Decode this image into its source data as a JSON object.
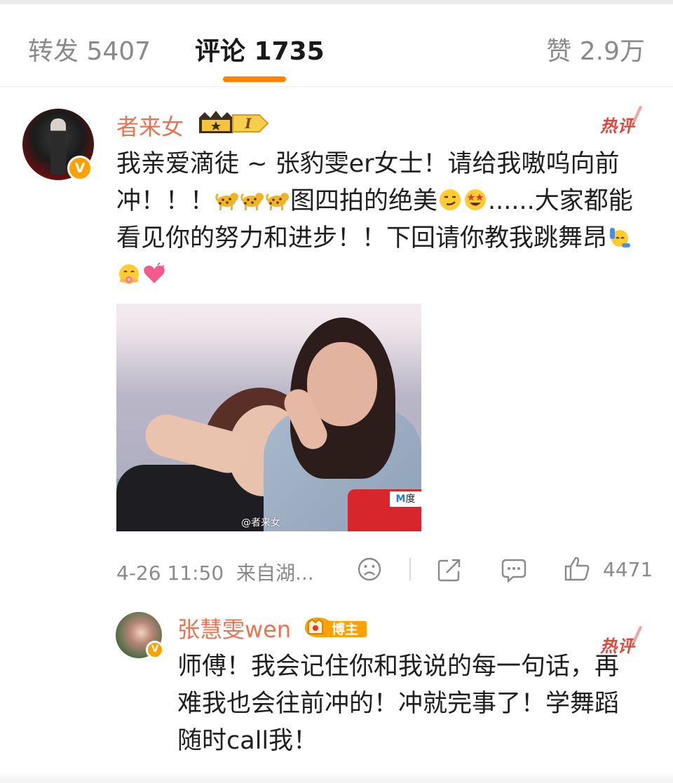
{
  "tabs": {
    "repost": "转发 5407",
    "comments": "评论 1735",
    "likes": "赞 2.9万"
  },
  "colors": {
    "accent": "#ff8200",
    "username": "#eb7350",
    "hot": "#e2463a",
    "verified": "#ffa200"
  },
  "comment": {
    "username": "者来女",
    "level_badge": "I",
    "hot_label": "热评",
    "verified_badge": "V",
    "text_1": "我亲爱滴徒 ~ 张豹雯er女士！请给我嗷呜向前冲！！！",
    "text_2": "图四拍的绝美",
    "text_3": "......大家都能看见你的努力和进步！！下回请你教我跳舞昂",
    "image": {
      "watermark": "@者来女",
      "logo_text": "度"
    },
    "time": "4-26 11:50",
    "source": "来自湖...",
    "like_count": "4471"
  },
  "reply": {
    "username": "张慧雯wen",
    "badge_label": "博主",
    "hot_label": "热评",
    "verified_badge": "V",
    "text": "师傅！我会记住你和我说的每一句话，再难我也会往前冲的！冲就完事了！学舞蹈随时call我！"
  },
  "icons": [
    "leopard-emoji",
    "smirk-emoji",
    "star-struck-emoji",
    "raising-hand-emoji",
    "flower-hug-emoji",
    "heart-emoji",
    "dislike-icon",
    "share-icon",
    "comment-icon",
    "like-icon"
  ]
}
